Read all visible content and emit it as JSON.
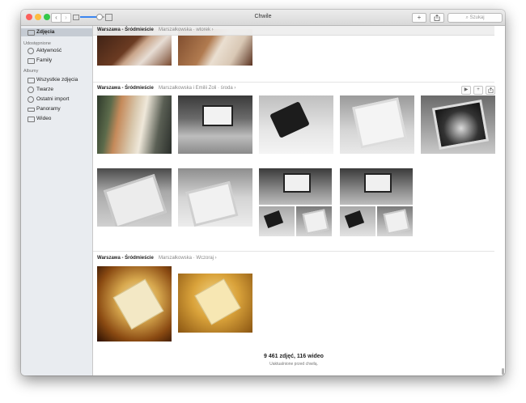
{
  "window": {
    "title": "Chwile"
  },
  "toolbar": {
    "back_icon": "chevron-left-icon",
    "forward_icon": "chevron-right-icon",
    "add_label": "+",
    "share_icon": "share-icon",
    "search_placeholder": "Szukaj",
    "search_icon": "magnifier-icon"
  },
  "sidebar": {
    "top_item": "Zdjęcia",
    "shared_header": "Udostępnione",
    "shared_items": [
      "Aktywność",
      "Family"
    ],
    "albums_header": "Albumy",
    "album_items": [
      "Wszystkie zdjęcia",
      "Twarze",
      "Ostatni import",
      "Panoramy",
      "Wideo"
    ]
  },
  "moments": [
    {
      "title": "Warszawa - Śródmieście",
      "subtitle": "Marszałkowska · wtorek ›"
    },
    {
      "title": "Warszawa - Śródmieście",
      "subtitle": "Marszałkowska i Emilii Zoli · środa ›"
    },
    {
      "title": "Warszawa - Śródmieście",
      "subtitle": "Marszałkowska · Wczoraj ›"
    }
  ],
  "moment_actions": {
    "play_icon": "play-icon",
    "add_label": "+",
    "share_icon": "share-icon"
  },
  "footer": {
    "count": "9 461 zdjęć, 116 wideo",
    "updated": "Uaktualnione przed chwilą."
  },
  "colors": {
    "accent": "#3b86f0",
    "sidebar_bg": "#e9ecf0",
    "selected_bg": "#c5cbd3"
  }
}
